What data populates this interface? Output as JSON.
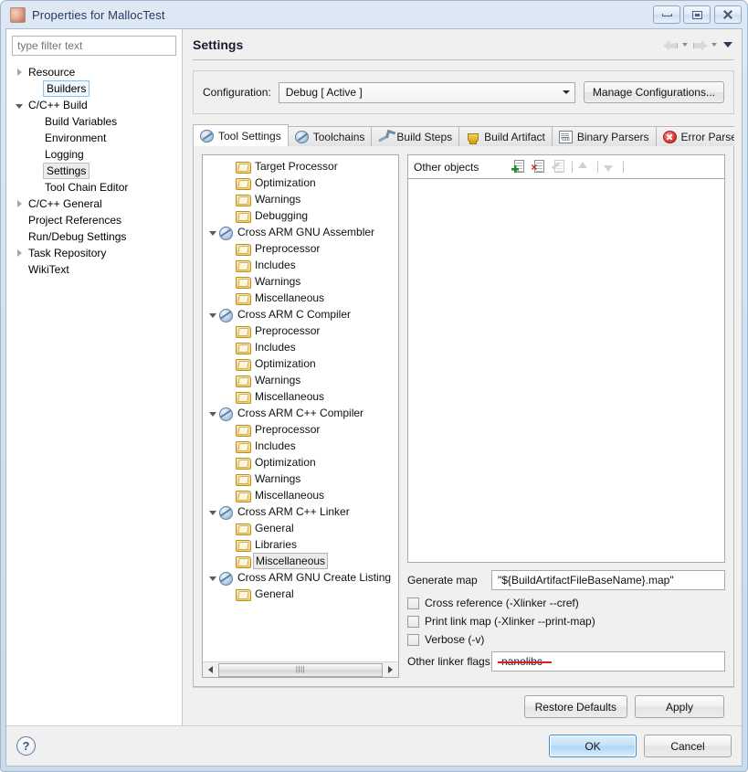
{
  "window": {
    "title": "Properties for MallocTest",
    "app_icon": "properties-app-icon",
    "controls": {
      "minimize": "minimize-icon",
      "maximize": "restore-icon",
      "close": "close-icon"
    }
  },
  "filter": {
    "placeholder": "type filter text",
    "value": ""
  },
  "nav_tree": [
    {
      "label": "Resource",
      "indent": 0,
      "twisty": "collapsed",
      "state": "normal"
    },
    {
      "label": "Builders",
      "indent": 1,
      "twisty": "none",
      "state": "focus"
    },
    {
      "label": "C/C++ Build",
      "indent": 0,
      "twisty": "expanded",
      "state": "normal"
    },
    {
      "label": "Build Variables",
      "indent": 1,
      "twisty": "none",
      "state": "normal"
    },
    {
      "label": "Environment",
      "indent": 1,
      "twisty": "none",
      "state": "normal"
    },
    {
      "label": "Logging",
      "indent": 1,
      "twisty": "none",
      "state": "normal"
    },
    {
      "label": "Settings",
      "indent": 1,
      "twisty": "none",
      "state": "selected"
    },
    {
      "label": "Tool Chain Editor",
      "indent": 1,
      "twisty": "none",
      "state": "normal"
    },
    {
      "label": "C/C++ General",
      "indent": 0,
      "twisty": "collapsed",
      "state": "normal"
    },
    {
      "label": "Project References",
      "indent": 0,
      "twisty": "none",
      "state": "normal"
    },
    {
      "label": "Run/Debug Settings",
      "indent": 0,
      "twisty": "none",
      "state": "normal"
    },
    {
      "label": "Task Repository",
      "indent": 0,
      "twisty": "collapsed",
      "state": "normal"
    },
    {
      "label": "WikiText",
      "indent": 0,
      "twisty": "none",
      "state": "normal"
    }
  ],
  "page": {
    "title": "Settings",
    "nav_back": "back-arrow-icon",
    "nav_forward": "forward-arrow-icon",
    "menu_chevron": "chevron-down-icon"
  },
  "configuration": {
    "label": "Configuration:",
    "selected": "Debug  [ Active ]",
    "manage_button": "Manage Configurations..."
  },
  "tabs": [
    {
      "label": "Tool Settings",
      "icon": "tool-icon",
      "active": true
    },
    {
      "label": "Toolchains",
      "icon": "tool-icon",
      "active": false
    },
    {
      "label": "Build Steps",
      "icon": "wrench-icon",
      "active": false
    },
    {
      "label": "Build Artifact",
      "icon": "trophy-icon",
      "active": false
    },
    {
      "label": "Binary Parsers",
      "icon": "binary-file-icon",
      "active": false
    },
    {
      "label": "Error Parsers",
      "icon": "error-circle-icon",
      "active": false
    }
  ],
  "tool_tree": [
    {
      "label": "Target Processor",
      "depth": 1,
      "icon": "folder-icon",
      "twisty": "none",
      "selected": false
    },
    {
      "label": "Optimization",
      "depth": 1,
      "icon": "folder-icon",
      "twisty": "none",
      "selected": false
    },
    {
      "label": "Warnings",
      "depth": 1,
      "icon": "folder-icon",
      "twisty": "none",
      "selected": false
    },
    {
      "label": "Debugging",
      "depth": 1,
      "icon": "folder-icon",
      "twisty": "none",
      "selected": false
    },
    {
      "label": "Cross ARM GNU Assembler",
      "depth": 0,
      "icon": "globe-icon",
      "twisty": "expanded",
      "selected": false
    },
    {
      "label": "Preprocessor",
      "depth": 1,
      "icon": "folder-icon",
      "twisty": "none",
      "selected": false
    },
    {
      "label": "Includes",
      "depth": 1,
      "icon": "folder-icon",
      "twisty": "none",
      "selected": false
    },
    {
      "label": "Warnings",
      "depth": 1,
      "icon": "folder-icon",
      "twisty": "none",
      "selected": false
    },
    {
      "label": "Miscellaneous",
      "depth": 1,
      "icon": "folder-icon",
      "twisty": "none",
      "selected": false
    },
    {
      "label": "Cross ARM C Compiler",
      "depth": 0,
      "icon": "globe-icon",
      "twisty": "expanded",
      "selected": false
    },
    {
      "label": "Preprocessor",
      "depth": 1,
      "icon": "folder-icon",
      "twisty": "none",
      "selected": false
    },
    {
      "label": "Includes",
      "depth": 1,
      "icon": "folder-icon",
      "twisty": "none",
      "selected": false
    },
    {
      "label": "Optimization",
      "depth": 1,
      "icon": "folder-icon",
      "twisty": "none",
      "selected": false
    },
    {
      "label": "Warnings",
      "depth": 1,
      "icon": "folder-icon",
      "twisty": "none",
      "selected": false
    },
    {
      "label": "Miscellaneous",
      "depth": 1,
      "icon": "folder-icon",
      "twisty": "none",
      "selected": false
    },
    {
      "label": "Cross ARM C++ Compiler",
      "depth": 0,
      "icon": "globe-icon",
      "twisty": "expanded",
      "selected": false
    },
    {
      "label": "Preprocessor",
      "depth": 1,
      "icon": "folder-icon",
      "twisty": "none",
      "selected": false
    },
    {
      "label": "Includes",
      "depth": 1,
      "icon": "folder-icon",
      "twisty": "none",
      "selected": false
    },
    {
      "label": "Optimization",
      "depth": 1,
      "icon": "folder-icon",
      "twisty": "none",
      "selected": false
    },
    {
      "label": "Warnings",
      "depth": 1,
      "icon": "folder-icon",
      "twisty": "none",
      "selected": false
    },
    {
      "label": "Miscellaneous",
      "depth": 1,
      "icon": "folder-icon",
      "twisty": "none",
      "selected": false
    },
    {
      "label": "Cross ARM C++ Linker",
      "depth": 0,
      "icon": "globe-icon",
      "twisty": "expanded",
      "selected": false
    },
    {
      "label": "General",
      "depth": 1,
      "icon": "folder-icon",
      "twisty": "none",
      "selected": false
    },
    {
      "label": "Libraries",
      "depth": 1,
      "icon": "folder-icon",
      "twisty": "none",
      "selected": false
    },
    {
      "label": "Miscellaneous",
      "depth": 1,
      "icon": "folder-icon",
      "twisty": "none",
      "selected": true
    },
    {
      "label": "Cross ARM GNU Create Listing",
      "depth": 0,
      "icon": "globe-icon",
      "twisty": "expanded",
      "selected": false
    },
    {
      "label": "General",
      "depth": 1,
      "icon": "folder-icon",
      "twisty": "none",
      "selected": false
    }
  ],
  "tool_tree_scrollbar": {
    "left_arrow": "scroll-left-icon",
    "right_arrow": "scroll-right-icon",
    "grip": "||||"
  },
  "other_objects": {
    "label": "Other objects",
    "items": [],
    "toolbar": [
      {
        "name": "add-object-button",
        "icon": "file-add-icon",
        "enabled": true
      },
      {
        "name": "delete-object-button",
        "icon": "file-delete-icon",
        "enabled": true
      },
      {
        "name": "edit-object-button",
        "icon": "file-edit-icon",
        "enabled": false
      },
      {
        "name": "move-up-button",
        "icon": "move-up-icon",
        "enabled": false
      },
      {
        "name": "move-down-button",
        "icon": "move-down-icon",
        "enabled": false
      }
    ]
  },
  "linker_options": {
    "generate_map_label": "Generate map",
    "generate_map_value": "\"${BuildArtifactFileBaseName}.map\"",
    "checkboxes": [
      {
        "label": "Cross reference (-Xlinker --cref)",
        "checked": false
      },
      {
        "label": "Print link map (-Xlinker --print-map)",
        "checked": false
      },
      {
        "label": "Verbose (-v)",
        "checked": false
      }
    ],
    "other_flags_label": "Other linker flags",
    "other_flags_value": "-nanolibc",
    "other_flags_marked_invalid": true
  },
  "footer": {
    "restore_defaults": "Restore Defaults",
    "apply": "Apply",
    "help_icon": "help-icon",
    "ok": "OK",
    "cancel": "Cancel"
  },
  "colors": {
    "window_chrome": "#d2e0ef",
    "dialog_bg": "#f0f0f0",
    "panel_white": "#ffffff",
    "accent_blue": "#3c8fd4",
    "error_red": "#e01b1b",
    "folder_yellow": "#f6cf63"
  }
}
